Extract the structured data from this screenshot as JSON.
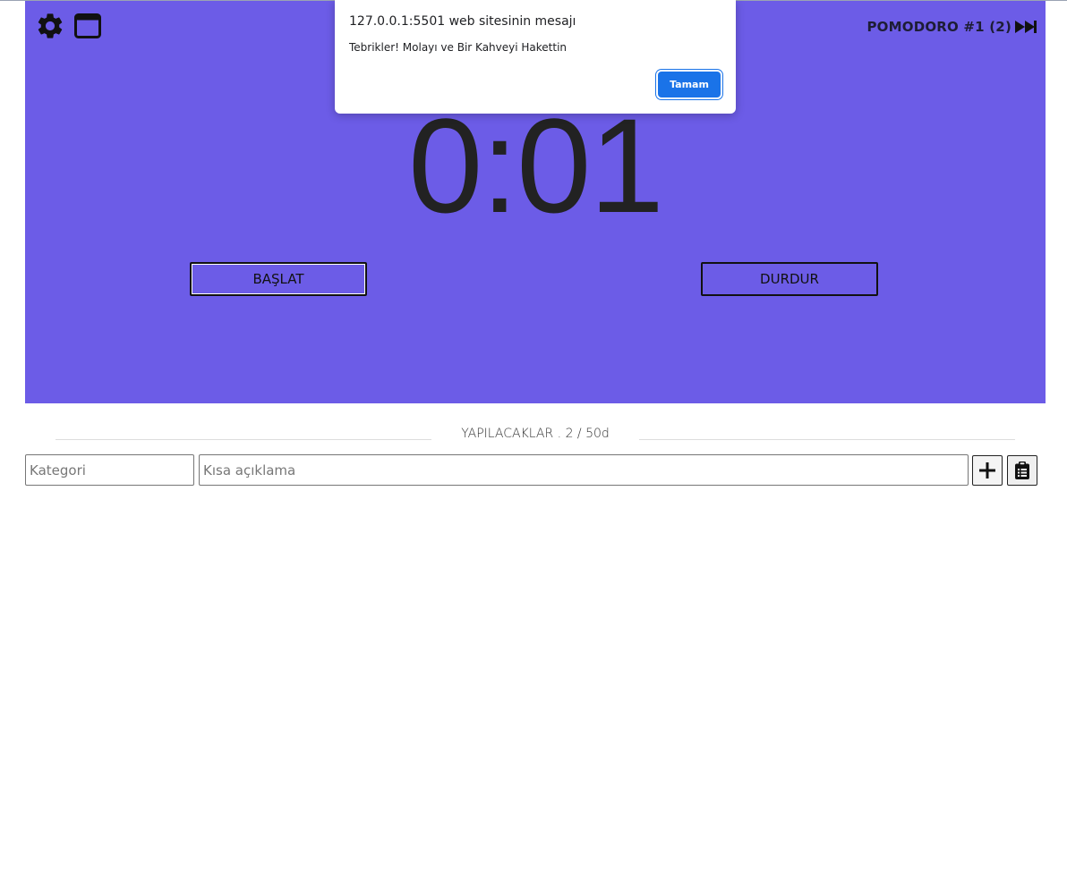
{
  "colors": {
    "panel_background": "#6c5ce7",
    "dialog_button": "#1a73e8"
  },
  "icons": {
    "settings": "gear-icon",
    "window": "browser-window-icon",
    "skip": "fast-forward-icon",
    "add": "plus-icon",
    "clipboard": "clipboard-list-icon"
  },
  "header": {
    "pomodoro_label": "POMODORO #1 (2)"
  },
  "timer": {
    "display": "0:01"
  },
  "controls": {
    "start_label": "BAŞLAT",
    "stop_label": "DURDUR"
  },
  "todo": {
    "title": "YAPILACAKLAR . 2 / 50d",
    "category_placeholder": "Kategori",
    "description_placeholder": "Kısa açıklama"
  },
  "dialog": {
    "title": "127.0.0.1:5501 web sitesinin mesajı",
    "message": "Tebrikler! Molayı ve Bir Kahveyi Hakettin",
    "ok_label": "Tamam"
  }
}
